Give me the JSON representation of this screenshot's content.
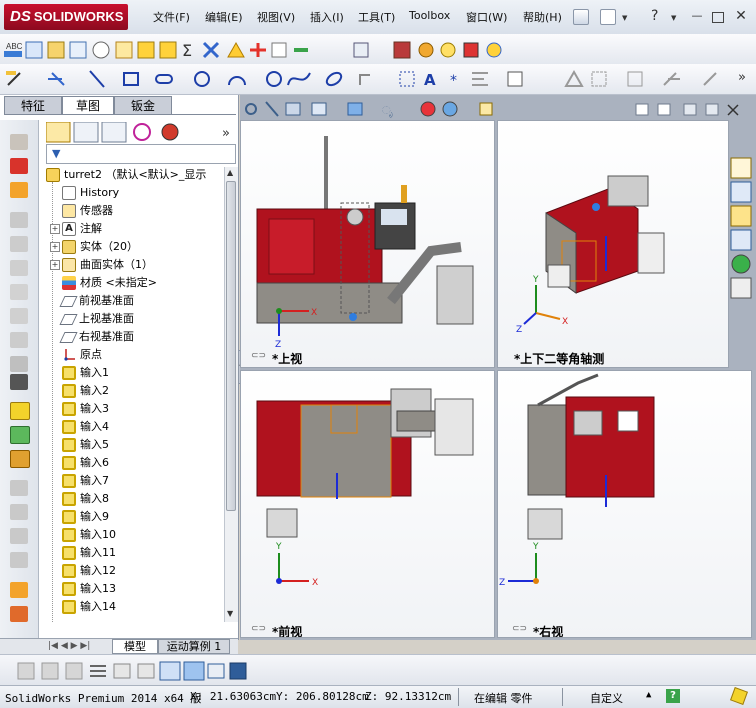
{
  "app": {
    "logo_prefix": "DS",
    "logo_text": "SOLIDWORKS"
  },
  "menu": [
    {
      "id": "file",
      "label": "文件(F)"
    },
    {
      "id": "edit",
      "label": "编辑(E)"
    },
    {
      "id": "view",
      "label": "视图(V)"
    },
    {
      "id": "insert",
      "label": "插入(I)"
    },
    {
      "id": "tools",
      "label": "工具(T)"
    },
    {
      "id": "toolbox",
      "label": "Toolbox"
    },
    {
      "id": "window",
      "label": "窗口(W)"
    },
    {
      "id": "help",
      "label": "帮助(H)"
    }
  ],
  "panel_tabs": {
    "features": "特征",
    "sketch": "草图",
    "sheetmetal": "钣金"
  },
  "tree": {
    "root": "turret2 （默认<默认>_显示",
    "items": [
      {
        "label": "History",
        "kind": "history"
      },
      {
        "label": "传感器",
        "kind": "sensor"
      },
      {
        "label": "注解",
        "kind": "annotation",
        "expand": true
      },
      {
        "label": "实体（20）",
        "kind": "solid",
        "expand": true
      },
      {
        "label": "曲面实体（1）",
        "kind": "surface",
        "expand": true
      },
      {
        "label": "材质 <未指定>",
        "kind": "material"
      },
      {
        "label": "前视基准面",
        "kind": "plane"
      },
      {
        "label": "上视基准面",
        "kind": "plane"
      },
      {
        "label": "右视基准面",
        "kind": "plane"
      },
      {
        "label": "原点",
        "kind": "origin"
      },
      {
        "label": "输入1",
        "kind": "input"
      },
      {
        "label": "输入2",
        "kind": "input"
      },
      {
        "label": "输入3",
        "kind": "input"
      },
      {
        "label": "输入4",
        "kind": "input"
      },
      {
        "label": "输入5",
        "kind": "input"
      },
      {
        "label": "输入6",
        "kind": "input"
      },
      {
        "label": "输入7",
        "kind": "input"
      },
      {
        "label": "输入8",
        "kind": "input"
      },
      {
        "label": "输入9",
        "kind": "input"
      },
      {
        "label": "输入10",
        "kind": "input"
      },
      {
        "label": "输入11",
        "kind": "input"
      },
      {
        "label": "输入12",
        "kind": "input"
      },
      {
        "label": "输入13",
        "kind": "input"
      },
      {
        "label": "输入14",
        "kind": "input"
      }
    ]
  },
  "bottom_tabs": {
    "model": "模型",
    "motion": "运动算例 1"
  },
  "viewports": {
    "top": "*上视",
    "iso": "*上下二等角轴测",
    "front": "*前视",
    "right": "*右视"
  },
  "axes": {
    "x": "X",
    "y": "Y",
    "z": "Z"
  },
  "status": {
    "product": "SolidWorks Premium 2014 x64 版",
    "x": "X: 21.63063cm",
    "y": "Y: 206.80128cm",
    "z": "Z: 92.13312cm",
    "mode": "在编辑 零件",
    "custom": "自定义"
  },
  "colors": {
    "brand": "#c8102e",
    "machine_red": "#b0121e",
    "axis_x": "#d42020",
    "axis_y": "#1d8c1d",
    "axis_z": "#1c2bd6"
  }
}
